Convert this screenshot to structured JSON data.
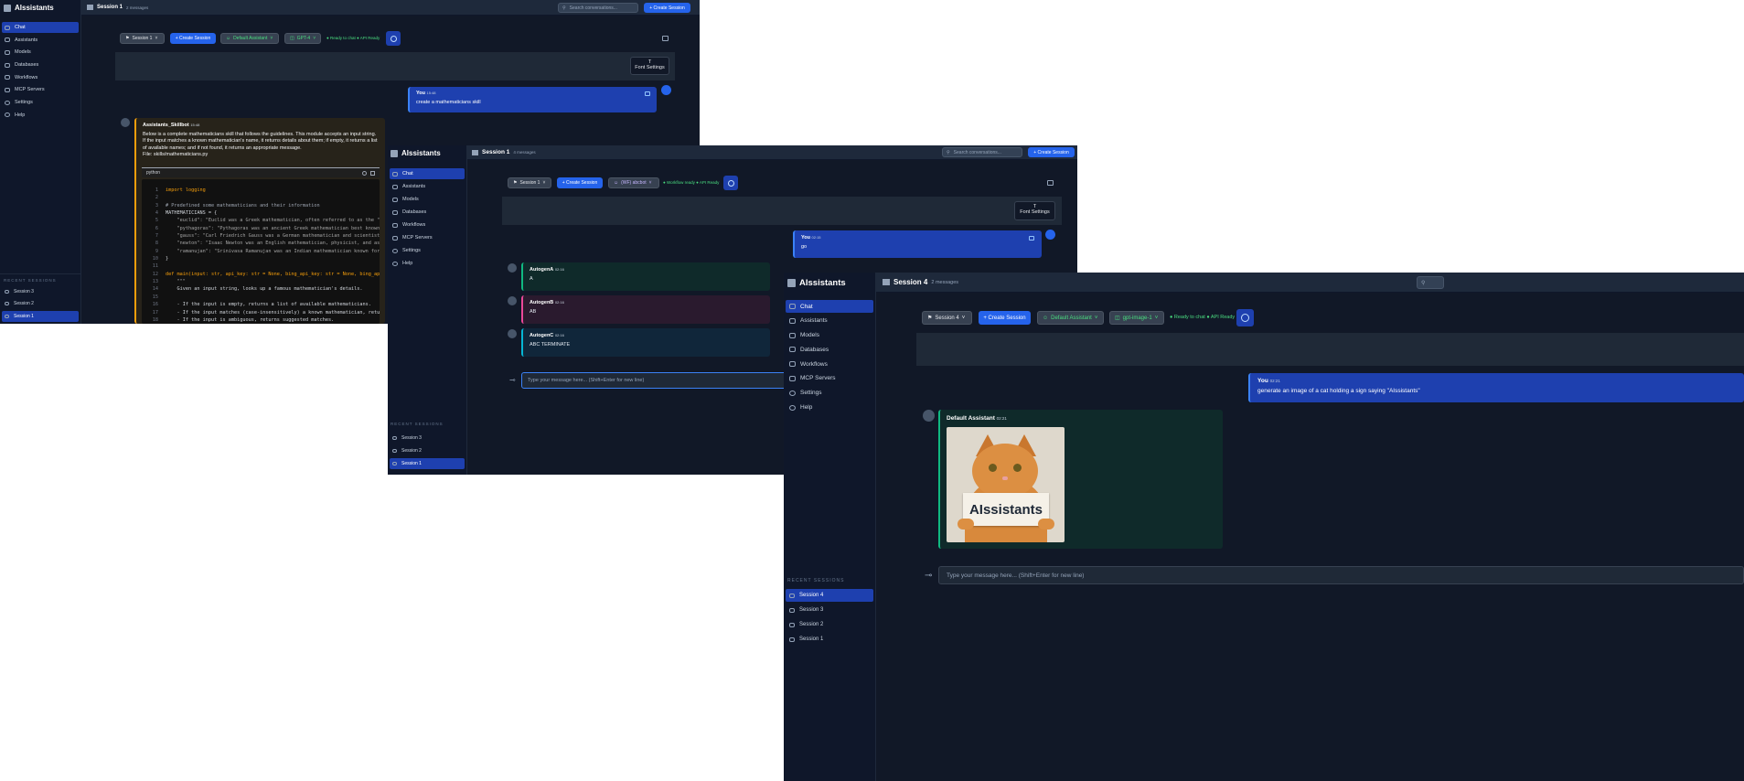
{
  "app": {
    "name": "AIssistants"
  },
  "nav": [
    "Chat",
    "Assistants",
    "Models",
    "Databases",
    "Workflows",
    "MCP Servers",
    "Settings",
    "Help"
  ],
  "recent_label": "RECENT SESSIONS",
  "search_placeholder": "Search conversations...",
  "create_session": "+ Create Session",
  "font_settings": "Font Settings",
  "composer_placeholder": "Type your message here... (Shift+Enter for new line)",
  "win1": {
    "title": "Session 1",
    "count": "2 messages",
    "session_select": "Session 1",
    "assistant_select": "Default Assistant",
    "model_select": "GPT-4",
    "status": "● Ready to chat  ● API Ready",
    "recent": [
      "Session 3",
      "Session 2",
      "Session 1"
    ],
    "user_msg": {
      "name": "You",
      "time": "15:48",
      "text": "create a mathematicians skill"
    },
    "bot_msg": {
      "name": "Assistants_Skillbot",
      "time": "15:48",
      "text": "Below is a complete mathematicians skill that follows the guidelines. This module accepts an input string. If the input matches a known mathematician's name, it returns details about them; if empty, it returns a list of available names; and if not found, it returns an appropriate message.",
      "file": "File: skills/mathematicians.py",
      "lang": "python"
    },
    "code": [
      [
        "1",
        "import logging"
      ],
      [
        "2",
        ""
      ],
      [
        "3",
        "# Predefined some mathematicians and their information"
      ],
      [
        "4",
        "MATHEMATICIANS = {"
      ],
      [
        "5",
        "    \"euclid\": \"Euclid was a Greek mathematician, often referred to as the \"F"
      ],
      [
        "6",
        "    \"pythagoras\": \"Pythagoras was an ancient Greek mathematician best known"
      ],
      [
        "7",
        "    \"gauss\": \"Carl Friedrich Gauss was a German mathematician and scientist"
      ],
      [
        "8",
        "    \"newton\": \"Isaac Newton was an English mathematician, physicist, and ast"
      ],
      [
        "9",
        "    \"ramanujan\": \"Srinivasa Ramanujan was an Indian mathematician known for"
      ],
      [
        "10",
        "}"
      ],
      [
        "11",
        ""
      ],
      [
        "12",
        "def main(input: str, api_key: str = None, bing_api_key: str = None, bing_api_"
      ],
      [
        "13",
        "    \"\"\""
      ],
      [
        "14",
        "    Given an input string, looks up a famous mathematician's details."
      ],
      [
        "15",
        ""
      ],
      [
        "16",
        "    - If the input is empty, returns a list of available mathematicians."
      ],
      [
        "17",
        "    - If the input matches (case-insensitively) a known mathematician, retur"
      ],
      [
        "18",
        "    - If the input is ambiguous, returns suggested matches."
      ]
    ]
  },
  "win2": {
    "title": "Session 1",
    "count": "4 messages",
    "session_select": "Session 1",
    "assistant_select": "(WF) abcbot",
    "status": "● Workflow ready  ● API Ready",
    "recent": [
      "Session 3",
      "Session 2",
      "Session 1"
    ],
    "user_msg": {
      "name": "You",
      "time": "02:15",
      "text": "go"
    },
    "bots": [
      {
        "name": "AutogenA",
        "time": "02:16",
        "text": "A"
      },
      {
        "name": "AutogenB",
        "time": "02:16",
        "text": "AB"
      },
      {
        "name": "AutogenC",
        "time": "02:16",
        "text": "ABC TERMINATE"
      }
    ]
  },
  "win3": {
    "title": "Session 4",
    "count": "2 messages",
    "session_select": "Session 4",
    "assistant_select": "Default Assistant",
    "model_select": "gpt-image-1",
    "status": "● Ready to chat  ● API Ready",
    "recent": [
      "Session 4",
      "Session 3",
      "Session 2",
      "Session 1"
    ],
    "user_msg": {
      "name": "You",
      "time": "02:21",
      "text": "generate an image of a cat holding a sign saying \"AIssistants\""
    },
    "bot_msg": {
      "name": "Default Assistant",
      "time": "02:21"
    },
    "sign_text": "AIssistants"
  },
  "colors": {
    "bg": "#111827",
    "sidebar": "#0f172a",
    "accent": "#2563eb",
    "status": "#4ade80"
  }
}
